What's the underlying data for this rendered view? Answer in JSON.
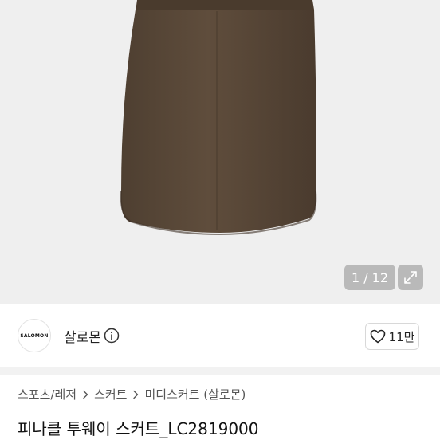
{
  "gallery": {
    "counter": "1 / 12",
    "image_alt": "skirt-product-photo"
  },
  "brand": {
    "logo_text": "SALOMON",
    "name": "살로몬"
  },
  "like": {
    "count": "11만"
  },
  "breadcrumb": {
    "items": [
      "스포츠/레저",
      "스커트",
      "미디스커트 (살로몬)"
    ]
  },
  "product": {
    "title": "피나클 투웨이 스커트_LC2819000"
  },
  "colors": {
    "skirt": "#5a4838",
    "background": "#efefef"
  }
}
